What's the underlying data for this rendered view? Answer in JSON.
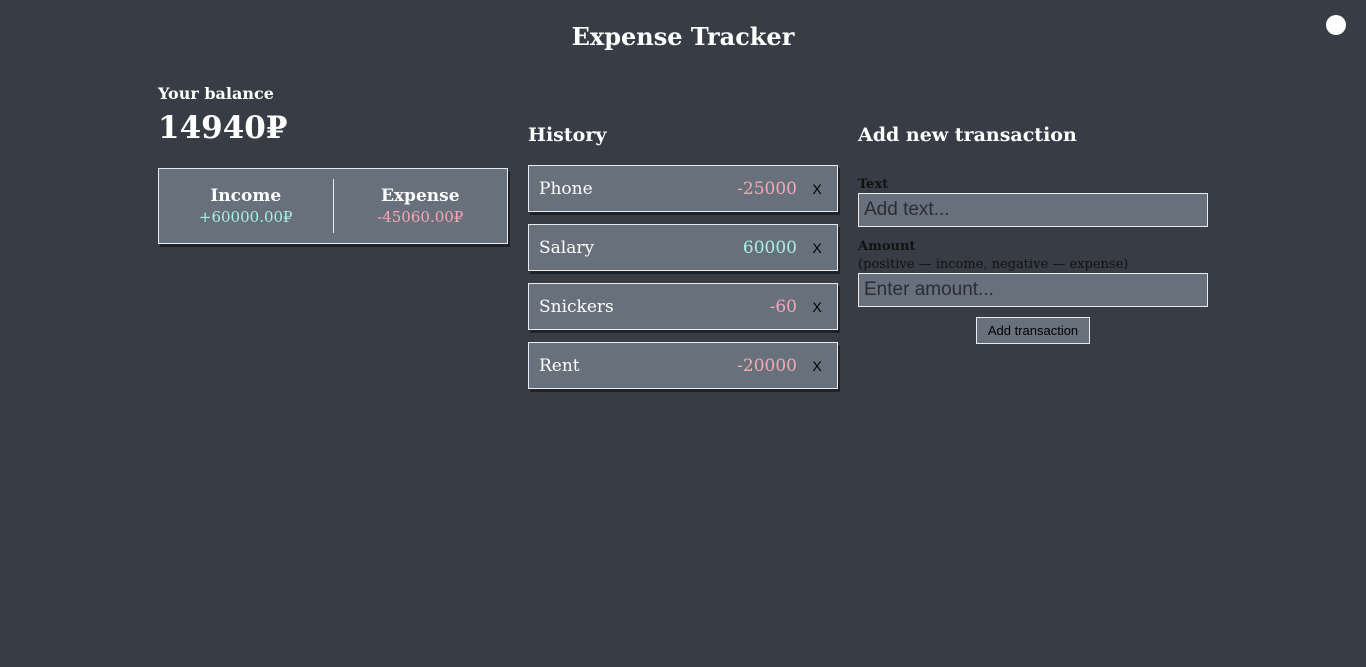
{
  "header": {
    "title": "Expense Tracker",
    "theme_toggle_icon": "circle-icon"
  },
  "balance": {
    "label": "Your balance",
    "amount": "14940₽"
  },
  "summary": {
    "income_label": "Income",
    "income_value": "+60000.00₽",
    "expense_label": "Expense",
    "expense_value": "-45060.00₽"
  },
  "history": {
    "heading": "History",
    "items": [
      {
        "text": "Phone",
        "amount": "-25000",
        "type": "expense",
        "delete_label": "X"
      },
      {
        "text": "Salary",
        "amount": "60000",
        "type": "income",
        "delete_label": "X"
      },
      {
        "text": "Snickers",
        "amount": "-60",
        "type": "expense",
        "delete_label": "X"
      },
      {
        "text": "Rent",
        "amount": "-20000",
        "type": "expense",
        "delete_label": "X"
      }
    ]
  },
  "form": {
    "heading": "Add new transaction",
    "text_label": "Text",
    "text_placeholder": "Add text...",
    "text_value": "",
    "amount_label": "Amount",
    "amount_hint": "(positive — income, negative — expense)",
    "amount_placeholder": "Enter amount...",
    "amount_value": "",
    "submit_label": "Add transaction"
  },
  "colors": {
    "background": "#383d45",
    "panel": "#67707b",
    "income": "#a8f0e8",
    "expense": "#f7a7b5"
  }
}
